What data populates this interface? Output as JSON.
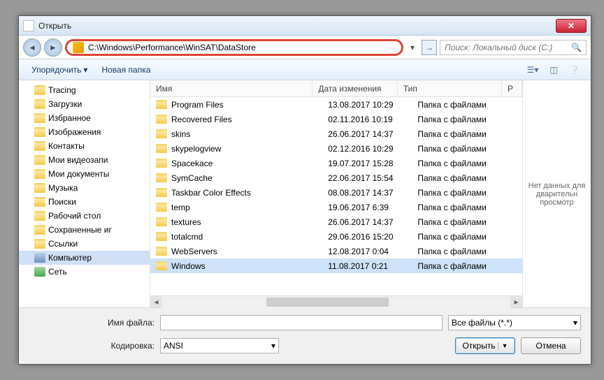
{
  "title": "Открыть",
  "address": "C:\\Windows\\Performance\\WinSAT\\DataStore",
  "search_placeholder": "Поиск: Локальный диск (C:)",
  "toolbar": {
    "organize": "Упорядочить",
    "newfolder": "Новая папка"
  },
  "columns": {
    "name": "Имя",
    "date": "Дата изменения",
    "type": "Тип",
    "size": "Р"
  },
  "tree": [
    {
      "label": "Tracing"
    },
    {
      "label": "Загрузки"
    },
    {
      "label": "Избранное"
    },
    {
      "label": "Изображения"
    },
    {
      "label": "Контакты"
    },
    {
      "label": "Мои видеозапи"
    },
    {
      "label": "Мои документы"
    },
    {
      "label": "Музыка"
    },
    {
      "label": "Поиски"
    },
    {
      "label": "Рабочий стол"
    },
    {
      "label": "Сохраненные иг"
    },
    {
      "label": "Ссылки"
    },
    {
      "label": "Компьютер",
      "kind": "comp",
      "sel": true
    },
    {
      "label": "Сеть",
      "kind": "net"
    }
  ],
  "files": [
    {
      "name": "Program Files",
      "date": "13.08.2017 10:29",
      "type": "Папка с файлами"
    },
    {
      "name": "Recovered Files",
      "date": "02.11.2016 10:19",
      "type": "Папка с файлами"
    },
    {
      "name": "skins",
      "date": "26.06.2017 14:37",
      "type": "Папка с файлами"
    },
    {
      "name": "skypelogview",
      "date": "02.12.2016 10:29",
      "type": "Папка с файлами"
    },
    {
      "name": "Spacekace",
      "date": "19.07.2017 15:28",
      "type": "Папка с файлами"
    },
    {
      "name": "SymCache",
      "date": "22.06.2017 15:54",
      "type": "Папка с файлами"
    },
    {
      "name": "Taskbar Color Effects",
      "date": "08.08.2017 14:37",
      "type": "Папка с файлами"
    },
    {
      "name": "temp",
      "date": "19.06.2017 6:39",
      "type": "Папка с файлами"
    },
    {
      "name": "textures",
      "date": "26.06.2017 14:37",
      "type": "Папка с файлами"
    },
    {
      "name": "totalcmd",
      "date": "29.06.2016 15:20",
      "type": "Папка с файлами"
    },
    {
      "name": "WebServers",
      "date": "12.08.2017 0:04",
      "type": "Папка с файлами"
    },
    {
      "name": "Windows",
      "date": "11.08.2017 0:21",
      "type": "Папка с файлами",
      "sel": true
    }
  ],
  "preview_text": "Нет данных для дварительн просмотр",
  "labels": {
    "filename": "Имя файла:",
    "encoding": "Кодировка:"
  },
  "encoding_value": "ANSI",
  "filter_value": "Все файлы (*.*)",
  "buttons": {
    "open": "Открыть",
    "cancel": "Отмена"
  },
  "filename_value": ""
}
